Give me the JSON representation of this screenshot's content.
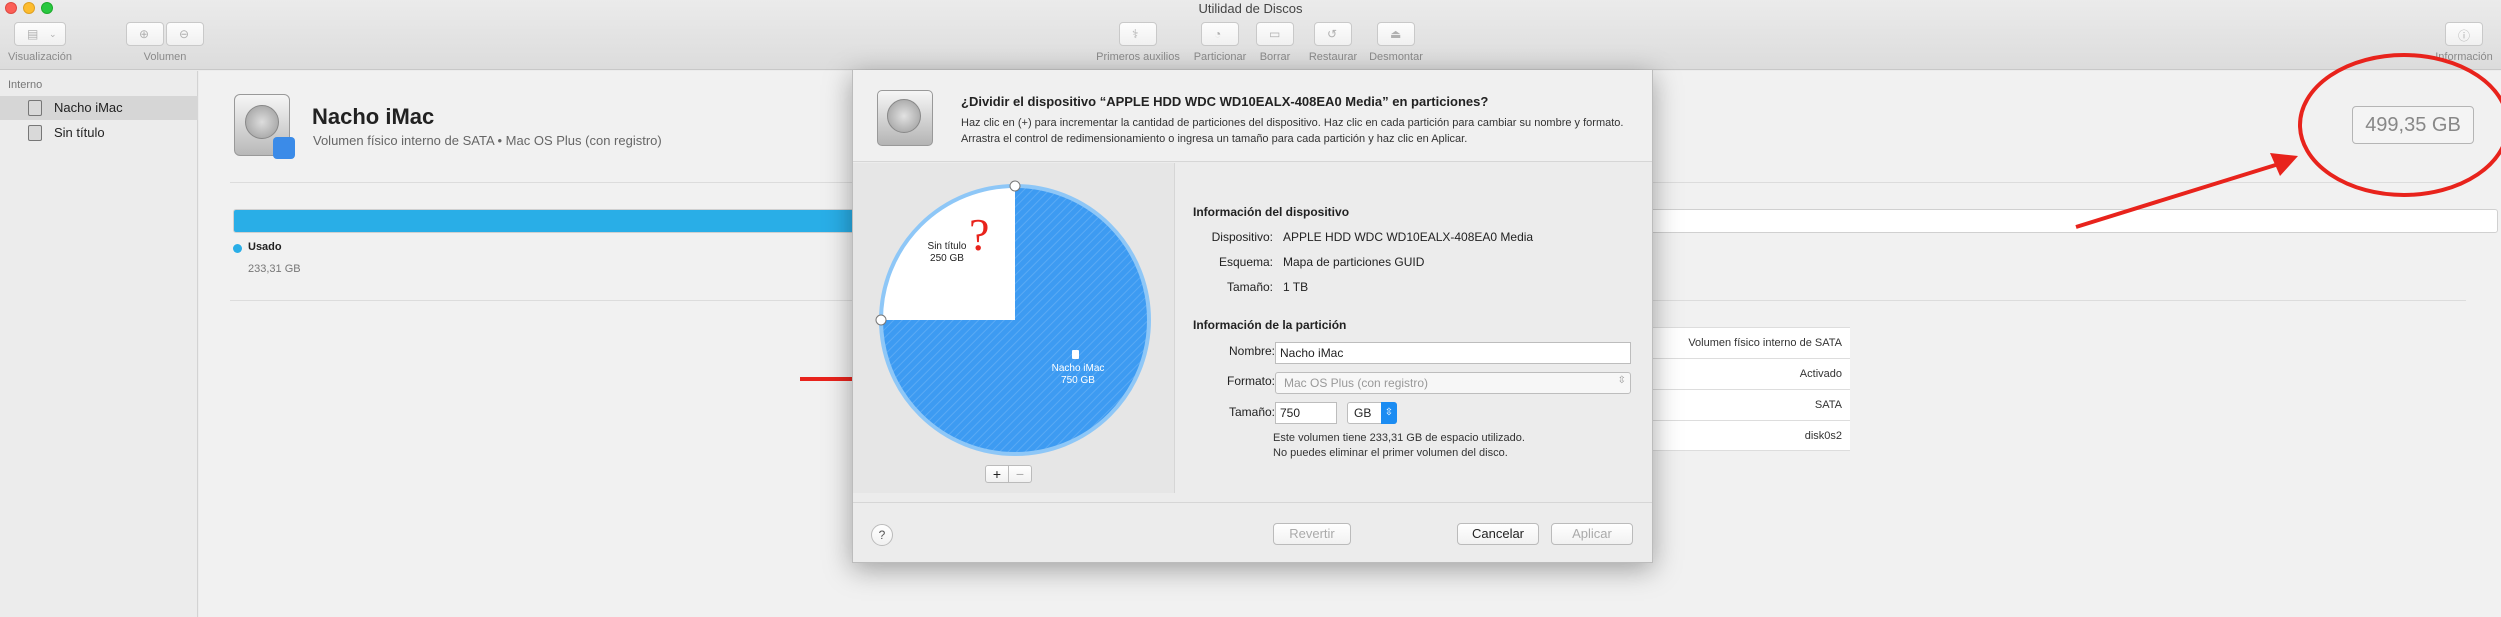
{
  "window": {
    "title": "Utilidad de Discos"
  },
  "toolbar": {
    "view_label": "Visualización",
    "volume_label": "Volumen",
    "first_aid_label": "Primeros auxilios",
    "partition_label": "Particionar",
    "erase_label": "Borrar",
    "restore_label": "Restaurar",
    "unmount_label": "Desmontar",
    "info_label": "Información"
  },
  "sidebar": {
    "section": "Interno",
    "items": [
      {
        "label": "Nacho iMac",
        "selected": true
      },
      {
        "label": "Sin título",
        "selected": false
      }
    ]
  },
  "volume": {
    "name": "Nacho iMac",
    "subtitle": "Volumen físico interno de SATA • Mac OS Plus (con registro)",
    "capacity": "499,35 GB",
    "used_label": "Usado",
    "used_value": "233,31 GB",
    "used_fraction": 0.467,
    "info_values": [
      "Volumen físico interno de SATA",
      "Activado",
      "SATA",
      "disk0s2"
    ]
  },
  "sheet": {
    "title": "¿Dividir el dispositivo “APPLE HDD WDC WD10EALX-408EA0 Media” en particiones?",
    "description": "Haz clic en (+) para incrementar la cantidad de particiones del dispositivo. Haz clic en cada partición para cambiar su nombre y formato. Arrastra el control de redimensionamiento o ingresa un tamaño para cada partición y haz clic en Aplicar.",
    "pie": {
      "slices": [
        {
          "name": "Sin título",
          "size": "250 GB",
          "value": 250
        },
        {
          "name": "Nacho iMac",
          "size": "750 GB",
          "value": 750
        }
      ],
      "question_mark": "?"
    },
    "add_label": "+",
    "remove_label": "−",
    "device_info_title": "Información del dispositivo",
    "device_label": "Dispositivo:",
    "device_value": "APPLE HDD WDC WD10EALX-408EA0 Media",
    "scheme_label": "Esquema:",
    "scheme_value": "Mapa de particiones GUID",
    "size_label": "Tamaño:",
    "size_value": "1 TB",
    "partition_info_title": "Información de la partición",
    "name_label": "Nombre:",
    "name_value": "Nacho iMac",
    "format_label": "Formato:",
    "format_value": "Mac OS Plus (con registro)",
    "psize_label": "Tamaño:",
    "psize_value": "750",
    "unit_value": "GB",
    "note_1": "Este volumen tiene 233,31 GB de espacio utilizado.",
    "note_2": "No puedes eliminar el primer volumen del disco.",
    "help_label": "?",
    "revert_label": "Revertir",
    "cancel_label": "Cancelar",
    "apply_label": "Aplicar"
  },
  "colors": {
    "accent": "#1b8cf2",
    "usage_bar": "#29aee7",
    "annotation": "#e8231c"
  }
}
